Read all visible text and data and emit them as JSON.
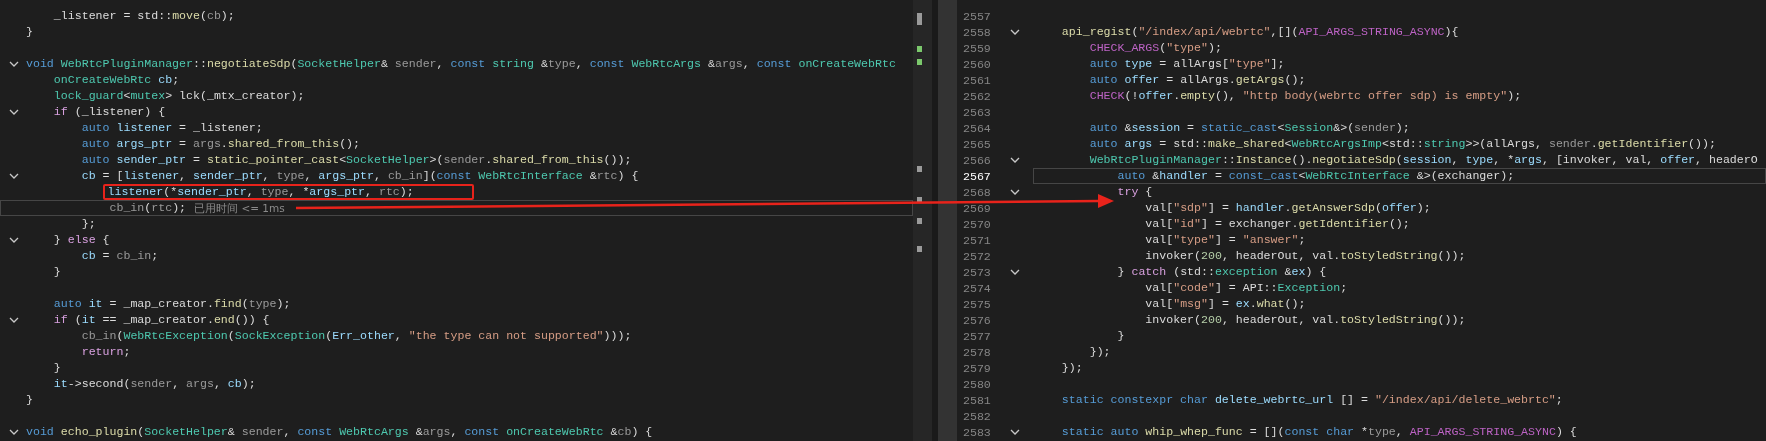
{
  "left_editor": {
    "lines": [
      {
        "tokens": [
          {
            "kind": "p",
            "text": "    _listener = std::"
          },
          {
            "kind": "f",
            "text": "move"
          },
          {
            "kind": "p",
            "text": "("
          },
          {
            "kind": "d",
            "text": "cb"
          },
          {
            "kind": "p",
            "text": ");"
          }
        ]
      },
      {
        "tokens": [
          {
            "kind": "p",
            "text": "}"
          }
        ]
      },
      {
        "blank_before": true,
        "fold": true,
        "tokens": [
          {
            "kind": "k",
            "text": "void "
          },
          {
            "kind": "t",
            "text": "WebRtcPluginManager"
          },
          {
            "kind": "p",
            "text": "::"
          },
          {
            "kind": "f",
            "text": "negotiateSdp"
          },
          {
            "kind": "p",
            "text": "("
          },
          {
            "kind": "t",
            "text": "SocketHelper"
          },
          {
            "kind": "p",
            "text": "& "
          },
          {
            "kind": "d",
            "text": "sender"
          },
          {
            "kind": "p",
            "text": ", "
          },
          {
            "kind": "k",
            "text": "const "
          },
          {
            "kind": "t",
            "text": "string "
          },
          {
            "kind": "p",
            "text": "&"
          },
          {
            "kind": "d",
            "text": "type"
          },
          {
            "kind": "p",
            "text": ", "
          },
          {
            "kind": "k",
            "text": "const "
          },
          {
            "kind": "t",
            "text": "WebRtcArgs "
          },
          {
            "kind": "p",
            "text": "&"
          },
          {
            "kind": "d",
            "text": "args"
          },
          {
            "kind": "p",
            "text": ", "
          },
          {
            "kind": "k",
            "text": "const "
          },
          {
            "kind": "t",
            "text": "onCreateWebRtc"
          }
        ]
      },
      {
        "tokens": [
          {
            "kind": "t",
            "text": "    onCreateWebRtc "
          },
          {
            "kind": "v",
            "text": "cb"
          },
          {
            "kind": "p",
            "text": ";"
          }
        ]
      },
      {
        "tokens": [
          {
            "kind": "t",
            "text": "    lock_guard"
          },
          {
            "kind": "p",
            "text": "<"
          },
          {
            "kind": "t",
            "text": "mutex"
          },
          {
            "kind": "p",
            "text": "> lck(_mtx_creator);"
          }
        ]
      },
      {
        "fold": true,
        "tokens": [
          {
            "kind": "c",
            "text": "    if "
          },
          {
            "kind": "p",
            "text": "(_listener) {"
          }
        ]
      },
      {
        "tokens": [
          {
            "kind": "k",
            "text": "        auto "
          },
          {
            "kind": "v",
            "text": "listener"
          },
          {
            "kind": "p",
            "text": " = _listener;"
          }
        ]
      },
      {
        "tokens": [
          {
            "kind": "k",
            "text": "        auto "
          },
          {
            "kind": "v",
            "text": "args_ptr"
          },
          {
            "kind": "p",
            "text": " = "
          },
          {
            "kind": "d",
            "text": "args"
          },
          {
            "kind": "p",
            "text": "."
          },
          {
            "kind": "f",
            "text": "shared_from_this"
          },
          {
            "kind": "p",
            "text": "();"
          }
        ]
      },
      {
        "tokens": [
          {
            "kind": "k",
            "text": "        auto "
          },
          {
            "kind": "v",
            "text": "sender_ptr"
          },
          {
            "kind": "p",
            "text": " = "
          },
          {
            "kind": "f",
            "text": "static_pointer_cast"
          },
          {
            "kind": "p",
            "text": "<"
          },
          {
            "kind": "t",
            "text": "SocketHelper"
          },
          {
            "kind": "p",
            "text": ">("
          },
          {
            "kind": "d",
            "text": "sender"
          },
          {
            "kind": "p",
            "text": "."
          },
          {
            "kind": "f",
            "text": "shared_from_this"
          },
          {
            "kind": "p",
            "text": "());"
          }
        ]
      },
      {
        "fold": true,
        "tokens": [
          {
            "kind": "v",
            "text": "        cb"
          },
          {
            "kind": "p",
            "text": " = ["
          },
          {
            "kind": "v",
            "text": "listener"
          },
          {
            "kind": "p",
            "text": ", "
          },
          {
            "kind": "v",
            "text": "sender_ptr"
          },
          {
            "kind": "p",
            "text": ", "
          },
          {
            "kind": "d",
            "text": "type"
          },
          {
            "kind": "p",
            "text": ", "
          },
          {
            "kind": "v",
            "text": "args_ptr"
          },
          {
            "kind": "p",
            "text": ", "
          },
          {
            "kind": "d",
            "text": "cb_in"
          },
          {
            "kind": "p",
            "text": "]("
          },
          {
            "kind": "k",
            "text": "const "
          },
          {
            "kind": "t",
            "text": "WebRtcInterface "
          },
          {
            "kind": "p",
            "text": "&"
          },
          {
            "kind": "d",
            "text": "rtc"
          },
          {
            "kind": "p",
            "text": ") {"
          }
        ]
      },
      {
        "boxed": true,
        "tokens": [
          {
            "kind": "v",
            "text": "            listener"
          },
          {
            "kind": "p",
            "text": "(*"
          },
          {
            "kind": "v",
            "text": "sender_ptr"
          },
          {
            "kind": "p",
            "text": ", "
          },
          {
            "kind": "d",
            "text": "type"
          },
          {
            "kind": "p",
            "text": ", *"
          },
          {
            "kind": "v",
            "text": "args_ptr"
          },
          {
            "kind": "p",
            "text": ", "
          },
          {
            "kind": "d",
            "text": "rtc"
          },
          {
            "kind": "p",
            "text": ");"
          }
        ]
      },
      {
        "current": true,
        "hint": "已用时间 <= 1ms",
        "tokens": [
          {
            "kind": "d",
            "text": "            cb_in"
          },
          {
            "kind": "p",
            "text": "("
          },
          {
            "kind": "d",
            "text": "rtc"
          },
          {
            "kind": "p",
            "text": ");"
          }
        ]
      },
      {
        "tokens": [
          {
            "kind": "p",
            "text": "        };"
          }
        ]
      },
      {
        "fold": true,
        "tokens": [
          {
            "kind": "p",
            "text": "    } "
          },
          {
            "kind": "c",
            "text": "else "
          },
          {
            "kind": "p",
            "text": "{"
          }
        ]
      },
      {
        "tokens": [
          {
            "kind": "v",
            "text": "        cb"
          },
          {
            "kind": "p",
            "text": " = "
          },
          {
            "kind": "d",
            "text": "cb_in"
          },
          {
            "kind": "p",
            "text": ";"
          }
        ]
      },
      {
        "tokens": [
          {
            "kind": "p",
            "text": "    }"
          }
        ]
      },
      {
        "blank_before": true,
        "tokens": [
          {
            "kind": "k",
            "text": "    auto "
          },
          {
            "kind": "v",
            "text": "it"
          },
          {
            "kind": "p",
            "text": " = _map_creator."
          },
          {
            "kind": "f",
            "text": "find"
          },
          {
            "kind": "p",
            "text": "("
          },
          {
            "kind": "d",
            "text": "type"
          },
          {
            "kind": "p",
            "text": ");"
          }
        ]
      },
      {
        "fold": true,
        "tokens": [
          {
            "kind": "c",
            "text": "    if "
          },
          {
            "kind": "p",
            "text": "("
          },
          {
            "kind": "v",
            "text": "it"
          },
          {
            "kind": "p",
            "text": " == _map_creator."
          },
          {
            "kind": "f",
            "text": "end"
          },
          {
            "kind": "p",
            "text": "()) {"
          }
        ]
      },
      {
        "tokens": [
          {
            "kind": "d",
            "text": "        cb_in"
          },
          {
            "kind": "p",
            "text": "("
          },
          {
            "kind": "t",
            "text": "WebRtcException"
          },
          {
            "kind": "p",
            "text": "("
          },
          {
            "kind": "t",
            "text": "SockException"
          },
          {
            "kind": "p",
            "text": "("
          },
          {
            "kind": "v",
            "text": "Err_other"
          },
          {
            "kind": "p",
            "text": ", "
          },
          {
            "kind": "s",
            "text": "\"the type can not supported\""
          },
          {
            "kind": "p",
            "text": ")));"
          }
        ]
      },
      {
        "tokens": [
          {
            "kind": "c",
            "text": "        return"
          },
          {
            "kind": "p",
            "text": ";"
          }
        ]
      },
      {
        "tokens": [
          {
            "kind": "p",
            "text": "    }"
          }
        ]
      },
      {
        "tokens": [
          {
            "kind": "v",
            "text": "    it"
          },
          {
            "kind": "p",
            "text": "->second("
          },
          {
            "kind": "d",
            "text": "sender"
          },
          {
            "kind": "p",
            "text": ", "
          },
          {
            "kind": "d",
            "text": "args"
          },
          {
            "kind": "p",
            "text": ", "
          },
          {
            "kind": "v",
            "text": "cb"
          },
          {
            "kind": "p",
            "text": ");"
          }
        ]
      },
      {
        "tokens": [
          {
            "kind": "p",
            "text": "}"
          }
        ]
      },
      {
        "blank_before": true,
        "fold": true,
        "tokens": [
          {
            "kind": "k",
            "text": "void "
          },
          {
            "kind": "f",
            "text": "echo_plugin"
          },
          {
            "kind": "p",
            "text": "("
          },
          {
            "kind": "t",
            "text": "SocketHelper"
          },
          {
            "kind": "p",
            "text": "& "
          },
          {
            "kind": "d",
            "text": "sender"
          },
          {
            "kind": "p",
            "text": ", "
          },
          {
            "kind": "k",
            "text": "const "
          },
          {
            "kind": "t",
            "text": "WebRtcArgs "
          },
          {
            "kind": "p",
            "text": "&"
          },
          {
            "kind": "d",
            "text": "args"
          },
          {
            "kind": "p",
            "text": ", "
          },
          {
            "kind": "k",
            "text": "const "
          },
          {
            "kind": "t",
            "text": "onCreateWebRtc "
          },
          {
            "kind": "p",
            "text": "&"
          },
          {
            "kind": "d",
            "text": "cb"
          },
          {
            "kind": "p",
            "text": ") {"
          }
        ]
      }
    ]
  },
  "right_editor": {
    "lines": [
      {
        "num": "2557"
      },
      {
        "num": "2558",
        "fold": true,
        "tokens": [
          {
            "kind": "f",
            "text": "    api_regist"
          },
          {
            "kind": "p",
            "text": "("
          },
          {
            "kind": "s",
            "text": "\"/index/api/webrtc\""
          },
          {
            "kind": "p",
            "text": ",[]("
          },
          {
            "kind": "m",
            "text": "API_ARGS_STRING_ASYNC"
          },
          {
            "kind": "p",
            "text": "){"
          }
        ]
      },
      {
        "num": "2559",
        "tokens": [
          {
            "kind": "m",
            "text": "        CHECK_ARGS"
          },
          {
            "kind": "p",
            "text": "("
          },
          {
            "kind": "s",
            "text": "\"type\""
          },
          {
            "kind": "p",
            "text": ");"
          }
        ]
      },
      {
        "num": "2560",
        "tokens": [
          {
            "kind": "k",
            "text": "        auto "
          },
          {
            "kind": "v",
            "text": "type"
          },
          {
            "kind": "p",
            "text": " = allArgs["
          },
          {
            "kind": "s",
            "text": "\"type\""
          },
          {
            "kind": "p",
            "text": "];"
          }
        ]
      },
      {
        "num": "2561",
        "tokens": [
          {
            "kind": "k",
            "text": "        auto "
          },
          {
            "kind": "v",
            "text": "offer"
          },
          {
            "kind": "p",
            "text": " = allArgs."
          },
          {
            "kind": "f",
            "text": "getArgs"
          },
          {
            "kind": "p",
            "text": "();"
          }
        ]
      },
      {
        "num": "2562",
        "tokens": [
          {
            "kind": "m",
            "text": "        CHECK"
          },
          {
            "kind": "p",
            "text": "(!"
          },
          {
            "kind": "v",
            "text": "offer"
          },
          {
            "kind": "p",
            "text": "."
          },
          {
            "kind": "f",
            "text": "empty"
          },
          {
            "kind": "p",
            "text": "(), "
          },
          {
            "kind": "s",
            "text": "\"http body(webrtc offer sdp) is empty\""
          },
          {
            "kind": "p",
            "text": ");"
          }
        ]
      },
      {
        "num": "2563"
      },
      {
        "num": "2564",
        "tokens": [
          {
            "kind": "k",
            "text": "        auto "
          },
          {
            "kind": "p",
            "text": "&"
          },
          {
            "kind": "v",
            "text": "session"
          },
          {
            "kind": "p",
            "text": " = "
          },
          {
            "kind": "k",
            "text": "static_cast"
          },
          {
            "kind": "p",
            "text": "<"
          },
          {
            "kind": "t",
            "text": "Session"
          },
          {
            "kind": "p",
            "text": "&>("
          },
          {
            "kind": "d",
            "text": "sender"
          },
          {
            "kind": "p",
            "text": ");"
          }
        ]
      },
      {
        "num": "2565",
        "tokens": [
          {
            "kind": "k",
            "text": "        auto "
          },
          {
            "kind": "v",
            "text": "args"
          },
          {
            "kind": "p",
            "text": " = std::"
          },
          {
            "kind": "f",
            "text": "make_shared"
          },
          {
            "kind": "p",
            "text": "<"
          },
          {
            "kind": "t",
            "text": "WebRtcArgsImp"
          },
          {
            "kind": "p",
            "text": "<std::"
          },
          {
            "kind": "t",
            "text": "string"
          },
          {
            "kind": "p",
            "text": ">>(allArgs, "
          },
          {
            "kind": "d",
            "text": "sender"
          },
          {
            "kind": "p",
            "text": "."
          },
          {
            "kind": "f",
            "text": "getIdentifier"
          },
          {
            "kind": "p",
            "text": "());"
          }
        ]
      },
      {
        "num": "2566",
        "fold": true,
        "tokens": [
          {
            "kind": "t",
            "text": "        WebRtcPluginManager"
          },
          {
            "kind": "p",
            "text": "::"
          },
          {
            "kind": "f",
            "text": "Instance"
          },
          {
            "kind": "p",
            "text": "()."
          },
          {
            "kind": "f",
            "text": "negotiateSdp"
          },
          {
            "kind": "p",
            "text": "("
          },
          {
            "kind": "v",
            "text": "session"
          },
          {
            "kind": "p",
            "text": ", "
          },
          {
            "kind": "v",
            "text": "type"
          },
          {
            "kind": "p",
            "text": ", *"
          },
          {
            "kind": "v",
            "text": "args"
          },
          {
            "kind": "p",
            "text": ", [invoker, val, "
          },
          {
            "kind": "v",
            "text": "offer"
          },
          {
            "kind": "p",
            "text": ", headerO"
          }
        ]
      },
      {
        "num": "2567",
        "current": true,
        "tokens": [
          {
            "kind": "k",
            "text": "            auto "
          },
          {
            "kind": "p",
            "text": "&"
          },
          {
            "kind": "v",
            "text": "handler"
          },
          {
            "kind": "p",
            "text": " = "
          },
          {
            "kind": "k",
            "text": "const_cast"
          },
          {
            "kind": "p",
            "text": "<"
          },
          {
            "kind": "t",
            "text": "WebRtcInterface "
          },
          {
            "kind": "p",
            "text": "&>(exchanger);"
          }
        ]
      },
      {
        "num": "2568",
        "fold": true,
        "tokens": [
          {
            "kind": "c",
            "text": "            try "
          },
          {
            "kind": "p",
            "text": "{"
          }
        ]
      },
      {
        "num": "2569",
        "tokens": [
          {
            "kind": "p",
            "text": "                val["
          },
          {
            "kind": "s",
            "text": "\"sdp\""
          },
          {
            "kind": "p",
            "text": "] = "
          },
          {
            "kind": "v",
            "text": "handler"
          },
          {
            "kind": "p",
            "text": "."
          },
          {
            "kind": "f",
            "text": "getAnswerSdp"
          },
          {
            "kind": "p",
            "text": "("
          },
          {
            "kind": "v",
            "text": "offer"
          },
          {
            "kind": "p",
            "text": ");"
          }
        ]
      },
      {
        "num": "2570",
        "tokens": [
          {
            "kind": "p",
            "text": "                val["
          },
          {
            "kind": "s",
            "text": "\"id\""
          },
          {
            "kind": "p",
            "text": "] = exchanger."
          },
          {
            "kind": "f",
            "text": "getIdentifier"
          },
          {
            "kind": "p",
            "text": "();"
          }
        ]
      },
      {
        "num": "2571",
        "tokens": [
          {
            "kind": "p",
            "text": "                val["
          },
          {
            "kind": "s",
            "text": "\"type\""
          },
          {
            "kind": "p",
            "text": "] = "
          },
          {
            "kind": "s",
            "text": "\"answer\""
          },
          {
            "kind": "p",
            "text": ";"
          }
        ]
      },
      {
        "num": "2572",
        "tokens": [
          {
            "kind": "p",
            "text": "                invoker("
          },
          {
            "kind": "n",
            "text": "200"
          },
          {
            "kind": "p",
            "text": ", headerOut, val."
          },
          {
            "kind": "f",
            "text": "toStyledString"
          },
          {
            "kind": "p",
            "text": "());"
          }
        ]
      },
      {
        "num": "2573",
        "fold": true,
        "tokens": [
          {
            "kind": "p",
            "text": "            } "
          },
          {
            "kind": "c",
            "text": "catch "
          },
          {
            "kind": "p",
            "text": "(std::"
          },
          {
            "kind": "t",
            "text": "exception "
          },
          {
            "kind": "p",
            "text": "&"
          },
          {
            "kind": "v",
            "text": "ex"
          },
          {
            "kind": "p",
            "text": ") {"
          }
        ]
      },
      {
        "num": "2574",
        "tokens": [
          {
            "kind": "p",
            "text": "                val["
          },
          {
            "kind": "s",
            "text": "\"code\""
          },
          {
            "kind": "p",
            "text": "] = API::"
          },
          {
            "kind": "t",
            "text": "Exception"
          },
          {
            "kind": "p",
            "text": ";"
          }
        ]
      },
      {
        "num": "2575",
        "tokens": [
          {
            "kind": "p",
            "text": "                val["
          },
          {
            "kind": "s",
            "text": "\"msg\""
          },
          {
            "kind": "p",
            "text": "] = "
          },
          {
            "kind": "v",
            "text": "ex"
          },
          {
            "kind": "p",
            "text": "."
          },
          {
            "kind": "f",
            "text": "what"
          },
          {
            "kind": "p",
            "text": "();"
          }
        ]
      },
      {
        "num": "2576",
        "tokens": [
          {
            "kind": "p",
            "text": "                invoker("
          },
          {
            "kind": "n",
            "text": "200"
          },
          {
            "kind": "p",
            "text": ", headerOut, val."
          },
          {
            "kind": "f",
            "text": "toStyledString"
          },
          {
            "kind": "p",
            "text": "());"
          }
        ]
      },
      {
        "num": "2577",
        "tokens": [
          {
            "kind": "p",
            "text": "            }"
          }
        ]
      },
      {
        "num": "2578",
        "tokens": [
          {
            "kind": "p",
            "text": "        });"
          }
        ]
      },
      {
        "num": "2579",
        "tokens": [
          {
            "kind": "p",
            "text": "    });"
          }
        ]
      },
      {
        "num": "2580"
      },
      {
        "num": "2581",
        "tokens": [
          {
            "kind": "k",
            "text": "    static constexpr char "
          },
          {
            "kind": "v",
            "text": "delete_webrtc_url "
          },
          {
            "kind": "p",
            "text": "[] = "
          },
          {
            "kind": "s",
            "text": "\"/index/api/delete_webrtc\""
          },
          {
            "kind": "p",
            "text": ";"
          }
        ]
      },
      {
        "num": "2582"
      },
      {
        "num": "2583",
        "fold": true,
        "tokens": [
          {
            "kind": "k",
            "text": "    static auto "
          },
          {
            "kind": "f",
            "text": "whip_whep_func"
          },
          {
            "kind": "p",
            "text": " = []("
          },
          {
            "kind": "k",
            "text": "const char "
          },
          {
            "kind": "p",
            "text": "*"
          },
          {
            "kind": "d",
            "text": "type"
          },
          {
            "kind": "p",
            "text": ", "
          },
          {
            "kind": "m",
            "text": "API_ARGS_STRING_ASYNC"
          },
          {
            "kind": "p",
            "text": ") {"
          }
        ]
      }
    ]
  }
}
